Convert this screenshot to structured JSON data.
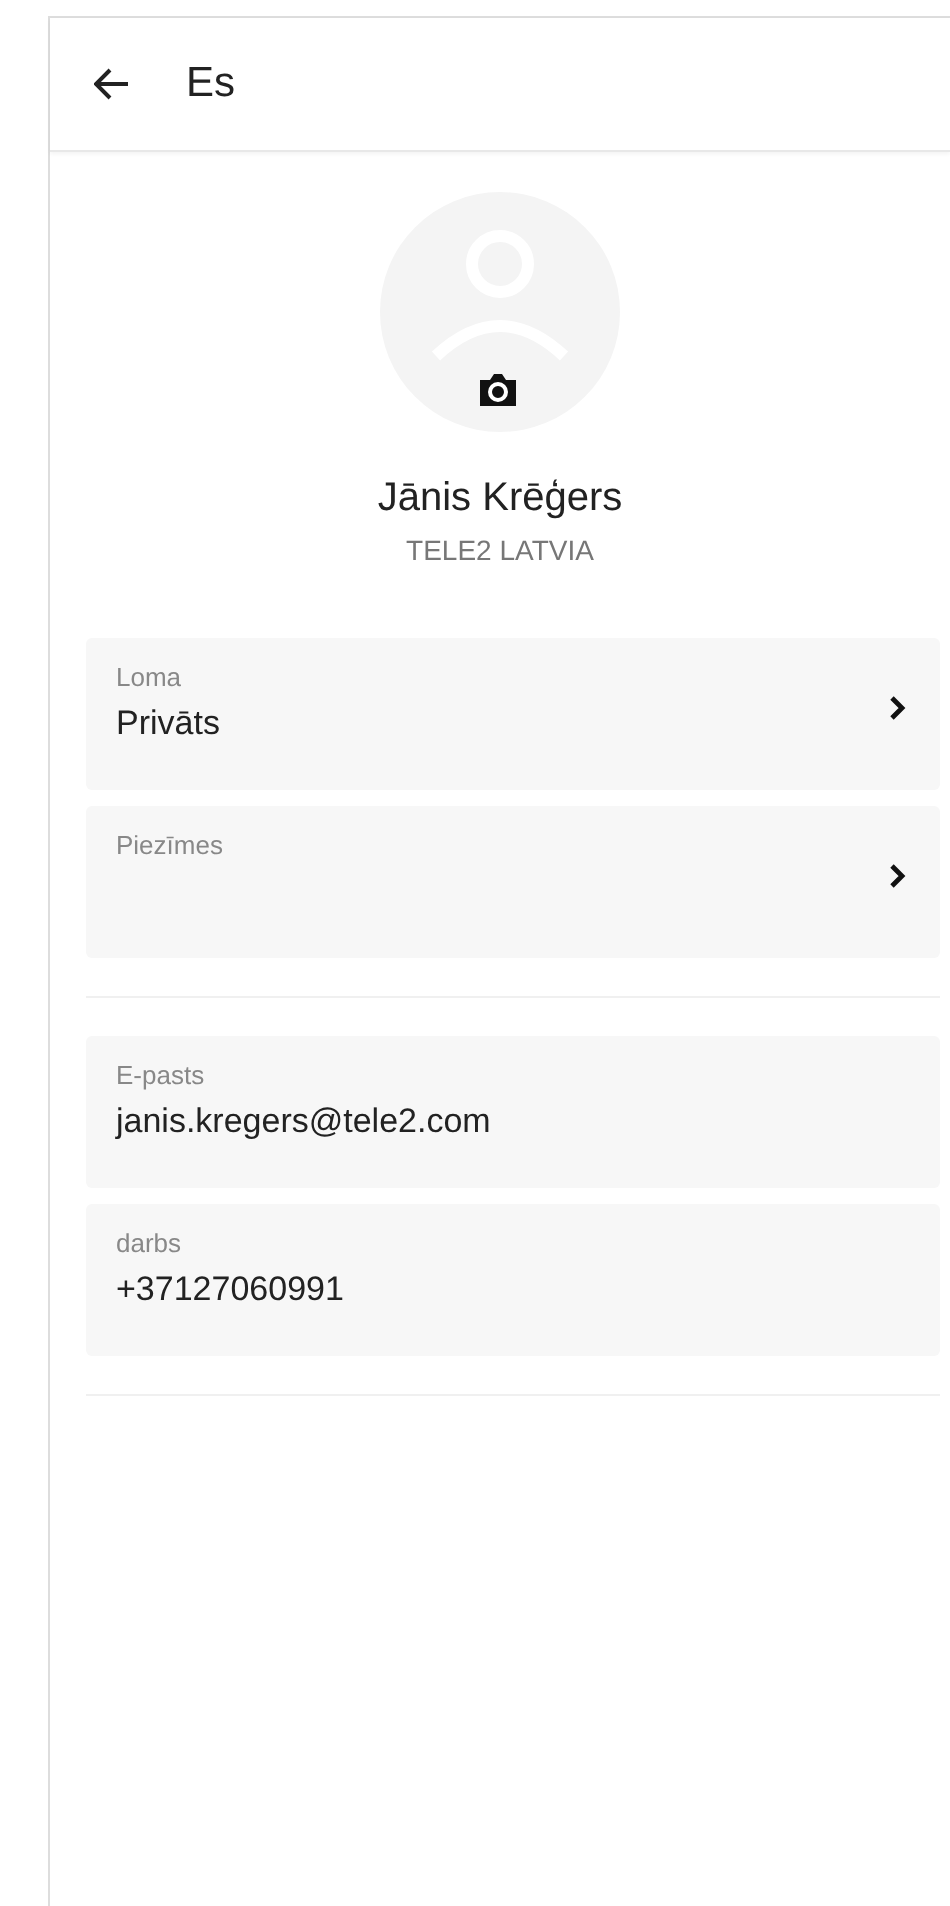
{
  "header": {
    "title": "Es"
  },
  "profile": {
    "name": "Jānis Krēģers",
    "company": "TELE2 LATVIA"
  },
  "sections": [
    {
      "fields": [
        {
          "kind": "link",
          "label": "Loma",
          "value": "Privāts"
        },
        {
          "kind": "link",
          "label": "Piezīmes"
        }
      ]
    },
    {
      "fields": [
        {
          "kind": "info",
          "label": "E-pasts",
          "value": "janis.kregers@tele2.com"
        },
        {
          "kind": "info",
          "label": "darbs",
          "value": "+37127060991"
        }
      ]
    }
  ]
}
